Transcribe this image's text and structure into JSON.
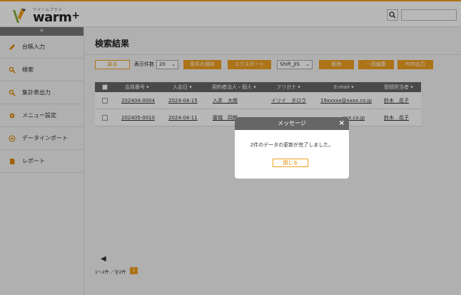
{
  "header": {
    "logo_small": "ウォームプラス",
    "logo_text": "warm",
    "logo_plus": "+"
  },
  "sidebar": {
    "collapse": "«",
    "items": [
      {
        "label": "台帳入力",
        "icon": "pencil-icon"
      },
      {
        "label": "検索",
        "icon": "search-icon"
      },
      {
        "label": "集計表出力",
        "icon": "search-icon"
      },
      {
        "label": "メニュー設定",
        "icon": "gear-icon"
      },
      {
        "label": "データインポート",
        "icon": "import-icon"
      },
      {
        "label": "レポート",
        "icon": "document-icon"
      }
    ]
  },
  "main": {
    "title": "検索結果",
    "toolbar": {
      "back": "戻る",
      "per_page_label": "表示件数",
      "per_page_value": "20",
      "save_condition": "条件の保存",
      "export": "エクスポート",
      "encoding_value": "Shift_JIS",
      "delete": "削除",
      "bulk_edit": "一括編集",
      "pdf": "PDF出力"
    },
    "table": {
      "headers": [
        "会員番号 ▾",
        "入会日 ▾",
        "契約者法人・個人 ▾",
        "フリガナ ▾",
        "E-mail ▾",
        "登録担当者 ▾"
      ],
      "rows": [
        [
          "202404-0004",
          "2024-04-15",
          "入井　大郎",
          "イリイ　タロウ",
          "19xxxxx@xxxx.co.jp",
          "鈴木　花子"
        ],
        [
          "202405-0010",
          "2024-04-11",
          "藤城　四郎",
          "",
          "xxx.co.jp",
          "鈴木　花子"
        ]
      ]
    },
    "pager": {
      "prev": "◀",
      "count": "1～2件 ／全2件",
      "page": "1"
    }
  },
  "modal": {
    "title": "メッセージ",
    "close": "×",
    "message": "2件のデータの更新が完了しました。",
    "button": "閉じる"
  },
  "colors": {
    "accent": "#f0a020",
    "header_gray": "#666666"
  }
}
